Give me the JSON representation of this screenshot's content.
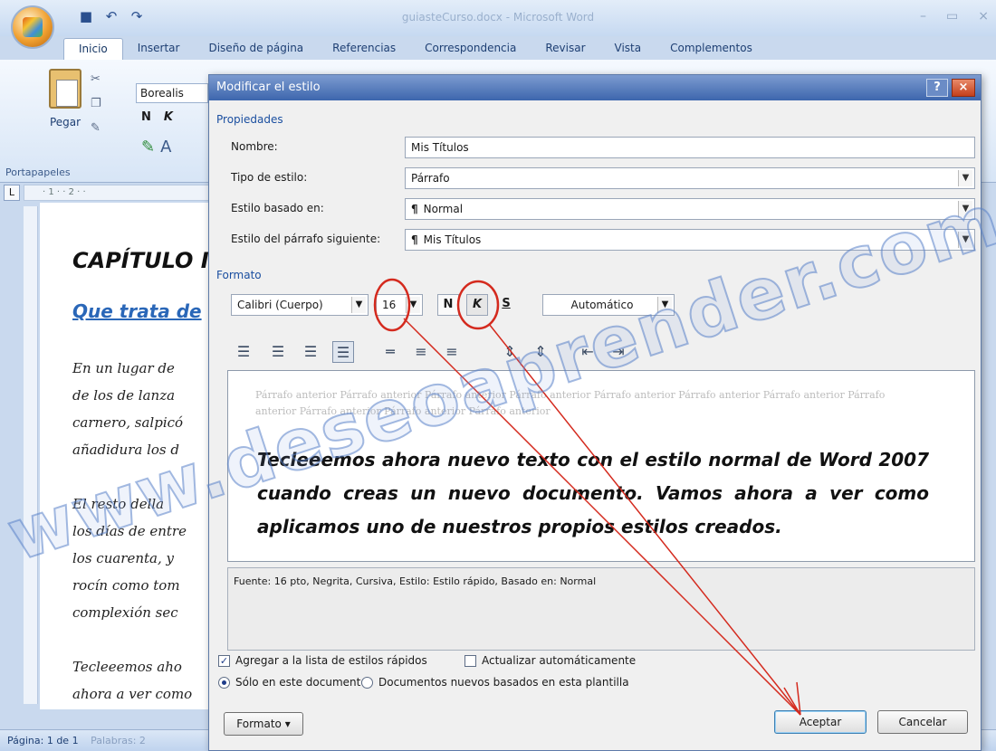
{
  "window": {
    "title": "guiasteCurso.docx - Microsoft Word",
    "tabs": [
      "Inicio",
      "Insertar",
      "Diseño de página",
      "Referencias",
      "Correspondencia",
      "Revisar",
      "Vista",
      "Complementos"
    ],
    "active_tab": "Inicio"
  },
  "ribbon": {
    "paste_label": "Pegar",
    "font_name": "Borealis",
    "clipboard_group": "Portapapeles"
  },
  "ruler": {
    "marks": "· 1 · · 2 · ·"
  },
  "document": {
    "heading1": "CAPÍTULO I",
    "heading2": "Que trata de",
    "lines": [
      "En un lugar de",
      "de los de lanza",
      "carnero, salpicó",
      "añadidura los d",
      "",
      "El resto della",
      "los días de entre",
      "los cuarenta, y",
      "rocín como tom",
      "complexión sec",
      "",
      "Tecleeemos aho",
      "ahora a ver como"
    ]
  },
  "status": {
    "page": "Página: 1 de 1",
    "words": "Palabras: 2"
  },
  "dialog": {
    "title": "Modificar el estilo",
    "help": "?",
    "close": "×",
    "section_props": "Propiedades",
    "name_label": "Nombre:",
    "name_value": "Mis Títulos",
    "type_label": "Tipo de estilo:",
    "type_value": "Párrafo",
    "based_label": "Estilo basado en:",
    "based_value": "Normal",
    "next_label": "Estilo del párrafo siguiente:",
    "next_value": "Mis Títulos",
    "section_format": "Formato",
    "font": "Calibri (Cuerpo)",
    "size": "16",
    "bold": "N",
    "italic": "K",
    "underline": "S",
    "color": "Automático",
    "preview_prev": "Párrafo anterior Párrafo anterior Párrafo anterior Párrafo anterior Párrafo anterior Párrafo anterior Párrafo anterior Párrafo anterior Párrafo anterior Párrafo anterior Párrafo anterior",
    "preview_text": "Tecleeemos ahora nuevo texto con el estilo normal de Word 2007 cuando creas un nuevo documento. Vamos ahora a ver como aplicamos uno de nuestros propios estilos creados.",
    "description": "Fuente: 16 pto, Negrita, Cursiva, Estilo: Estilo rápido, Basado en: Normal",
    "add_quick": "Agregar a la lista de estilos rápidos",
    "auto_update": "Actualizar automáticamente",
    "only_doc": "Sólo en este documento",
    "new_docs": "Documentos nuevos basados en esta plantilla",
    "format_btn": "Formato ▾",
    "ok": "Aceptar",
    "cancel": "Cancelar"
  },
  "watermark": "www.deseoaprender.com",
  "colors": {
    "annotation": "#d42a1e",
    "accent": "#1b4fa0",
    "titlebar": "#3d66ad"
  }
}
